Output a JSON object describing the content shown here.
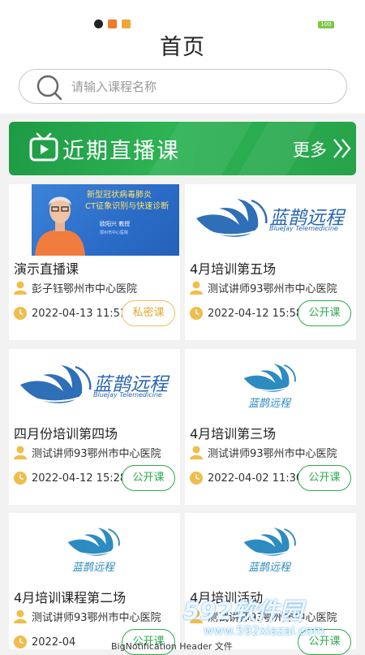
{
  "status_bar": {
    "battery": "100",
    "colors": {
      "qq": "#e8a33a",
      "mi": "#f07b2c",
      "msg": "#f0a83a"
    }
  },
  "header": {
    "title": "首页"
  },
  "search": {
    "placeholder": "请输入课程名称"
  },
  "banner": {
    "title": "近期直播课",
    "more": "更多"
  },
  "lecture_slide": {
    "line1": "新型冠状病毒肺炎",
    "line2": "CT征象识别与快速诊断",
    "speaker": "欧阳兴 教授",
    "affiliation": "鄂州市中心医院"
  },
  "logo": {
    "cn": "蓝鹊远程",
    "en": "BlueJay Telemedicine"
  },
  "courses": [
    {
      "title": "演示直播课",
      "host": "彭子钰鄂州市中心医院",
      "time": "2022-04-13 11:51",
      "tag": "私密课"
    },
    {
      "title": "4月培训第五场",
      "host": "测试讲师93鄂州市中心医院",
      "time": "2022-04-12 15:58",
      "tag": "公开课"
    },
    {
      "title": "四月份培训第四场",
      "host": "测试讲师93鄂州市中心医院",
      "time": "2022-04-12 15:28",
      "tag": "公开课"
    },
    {
      "title": "4月培训第三场",
      "host": "测试讲师93鄂州市中心医院",
      "time": "2022-04-02 11:30",
      "tag": "公开课"
    },
    {
      "title": "4月培训课程第二场",
      "host": "测试讲师93鄂州市中心医院",
      "time": "2022-04",
      "tag": "公开课"
    },
    {
      "title": "4月培训活动",
      "host": "测试讲师93鄂州市中心医院",
      "time": "",
      "tag": "公开课"
    }
  ],
  "notification": "BigNotification Header 文件",
  "watermark": {
    "brand": "592软件园",
    "url": "www.592xiazai.com"
  }
}
